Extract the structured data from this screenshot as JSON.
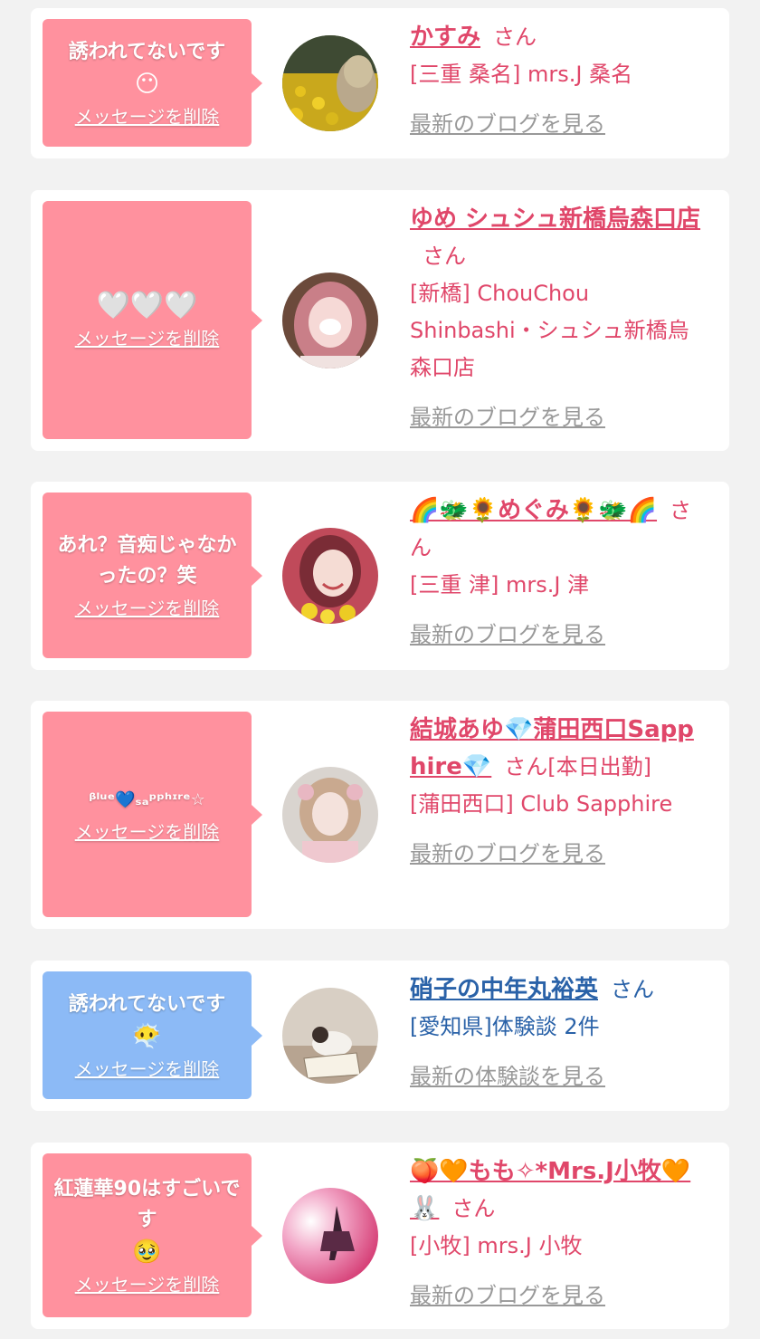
{
  "messages": [
    {
      "message_text": "誘われてないです",
      "message_emoji": "😶",
      "delete_label": "メッセージを削除",
      "name": "かすみ",
      "suffix": "さん",
      "shop": "[三重 桑名] mrs.J 桑名",
      "blog_link": "最新のブログを見る",
      "avatar_icon": "avatar-sunflower-field"
    },
    {
      "message_text": "",
      "message_emoji": "🤍🤍🤍",
      "delete_label": "メッセージを削除",
      "name": "ゆめ シュシュ新橋烏森口店",
      "suffix": "さん",
      "shop": "[新橋] ChouChou Shinbashi・シュシュ新橋烏森口店",
      "blog_link": "最新のブログを見る",
      "avatar_icon": "avatar-girl-pink"
    },
    {
      "message_text": "あれ？音痴じゃなかったの？笑",
      "message_emoji": "",
      "delete_label": "メッセージを削除",
      "name": "🌈🐲🌻めぐみ🌻🐲🌈",
      "suffix": "さん",
      "shop": "[三重 津] mrs.J 津",
      "blog_link": "最新のブログを見る",
      "avatar_icon": "avatar-woman-flowers"
    },
    {
      "message_text": "ᵝˡᵘᵉ💙ₛₐᵖᵖʰᶦʳᵉ☆",
      "message_emoji": "",
      "delete_label": "メッセージを削除",
      "name": "結城あゆ💎蒲田西口Sapphire💎",
      "suffix": "さん[本日出勤]",
      "shop": "[蒲田西口] Club Sapphire",
      "blog_link": "最新のブログを見る",
      "avatar_icon": "avatar-girl-kimono"
    },
    {
      "message_text": "誘われてないです",
      "message_emoji": "😶‍🌫️",
      "delete_label": "メッセージを削除",
      "name": "硝子の中年丸裕英",
      "suffix": "さん",
      "shop": "[愛知県]体験談 2件",
      "blog_link": "最新の体験談を見る",
      "avatar_icon": "avatar-cat-book"
    },
    {
      "message_text": "紅蓮華90はすごいです",
      "message_emoji": "🥹",
      "delete_label": "メッセージを削除",
      "name": "🍑🧡もも✧*Mrs.J小牧🧡🐰",
      "suffix": "さん",
      "shop": "[小牧] mrs.J 小牧",
      "blog_link": "最新のブログを見る",
      "avatar_icon": "avatar-dancer-pink"
    }
  ],
  "colors": {
    "bubble_pink": "#ff919e",
    "bubble_blue": "#8cbaf6",
    "name_pink": "#e0476a",
    "name_blue": "#2a62a8",
    "link_gray": "#999999",
    "background": "#f2f2f2"
  }
}
